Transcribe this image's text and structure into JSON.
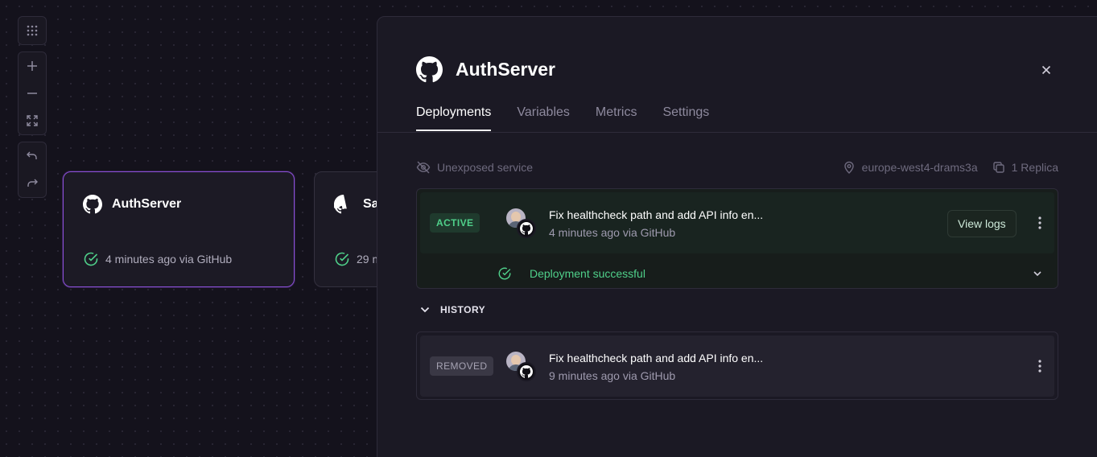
{
  "canvas": {
    "toolbar": {
      "group1": [
        {
          "icon": "grid-dots-icon",
          "name": "layout-button"
        }
      ],
      "group2": [
        {
          "icon": "plus-icon",
          "name": "zoom-in-button"
        },
        {
          "icon": "minus-icon",
          "name": "zoom-out-button"
        },
        {
          "icon": "fit-screen-icon",
          "name": "fit-view-button"
        }
      ],
      "group3": [
        {
          "icon": "undo-icon",
          "name": "undo-button"
        },
        {
          "icon": "redo-icon",
          "name": "redo-button"
        }
      ]
    },
    "services": [
      {
        "title": "AuthServer",
        "status": "4 minutes ago via GitHub",
        "selected": true
      },
      {
        "title": "Sa",
        "status": "29 m",
        "selected": false
      }
    ]
  },
  "panel": {
    "title": "AuthServer",
    "tabs": [
      "Deployments",
      "Variables",
      "Metrics",
      "Settings"
    ],
    "active_tab": 0,
    "meta": {
      "exposure": "Unexposed service",
      "region": "europe-west4-drams3a",
      "replicas": "1 Replica"
    },
    "active_deployment": {
      "badge": "ACTIVE",
      "message": "Fix healthcheck path and add API info en...",
      "sub": "4 minutes ago via GitHub",
      "view_logs": "View logs",
      "status": "Deployment successful"
    },
    "history_label": "HISTORY",
    "history": [
      {
        "badge": "REMOVED",
        "message": "Fix healthcheck path and add API info en...",
        "sub": "9 minutes ago via GitHub"
      }
    ]
  },
  "colors": {
    "background": "#14121c",
    "panel": "#1b1924",
    "accent_selected": "#8a4fd6",
    "success": "#4fd08a"
  }
}
